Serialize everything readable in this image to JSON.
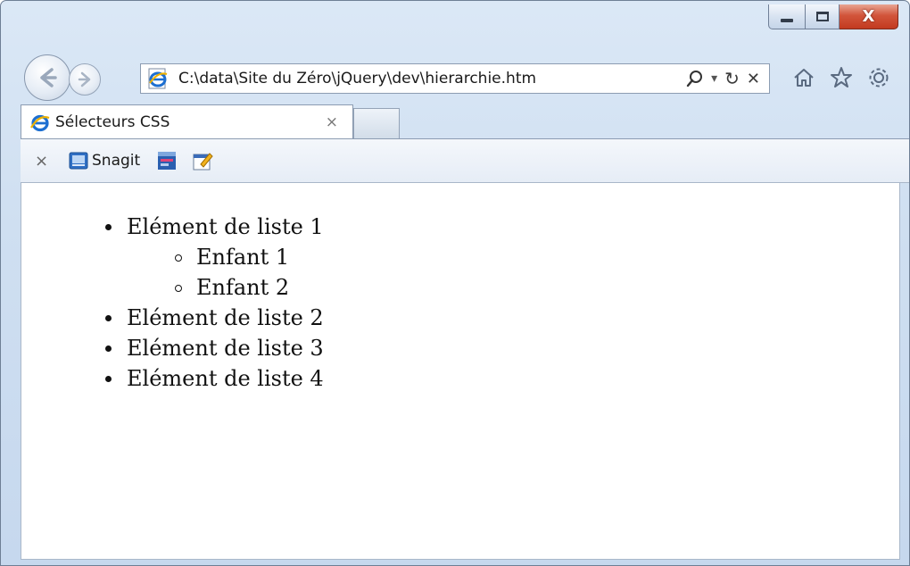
{
  "window": {
    "address": "C:\\data\\Site du Zéro\\jQuery\\dev\\hierarchie.htm",
    "tab_title": "Sélecteurs CSS",
    "tab_close": "×",
    "close_glyph": "X"
  },
  "address_tools": {
    "search": "⚲",
    "dropdown": "▾",
    "refresh": "↻",
    "stop": "✕"
  },
  "commandbar": {
    "close": "×",
    "snagit_label": "Snagit"
  },
  "content": {
    "items": [
      {
        "label": "Elément de liste 1",
        "children": [
          "Enfant 1",
          "Enfant 2"
        ]
      },
      {
        "label": "Elément de liste 2"
      },
      {
        "label": "Elément de liste 3"
      },
      {
        "label": "Elément de liste 4"
      }
    ]
  },
  "colors": {
    "frame": "#cfdff1",
    "close_button": "#c8432a",
    "ie_logo": "#1d6fd1"
  }
}
